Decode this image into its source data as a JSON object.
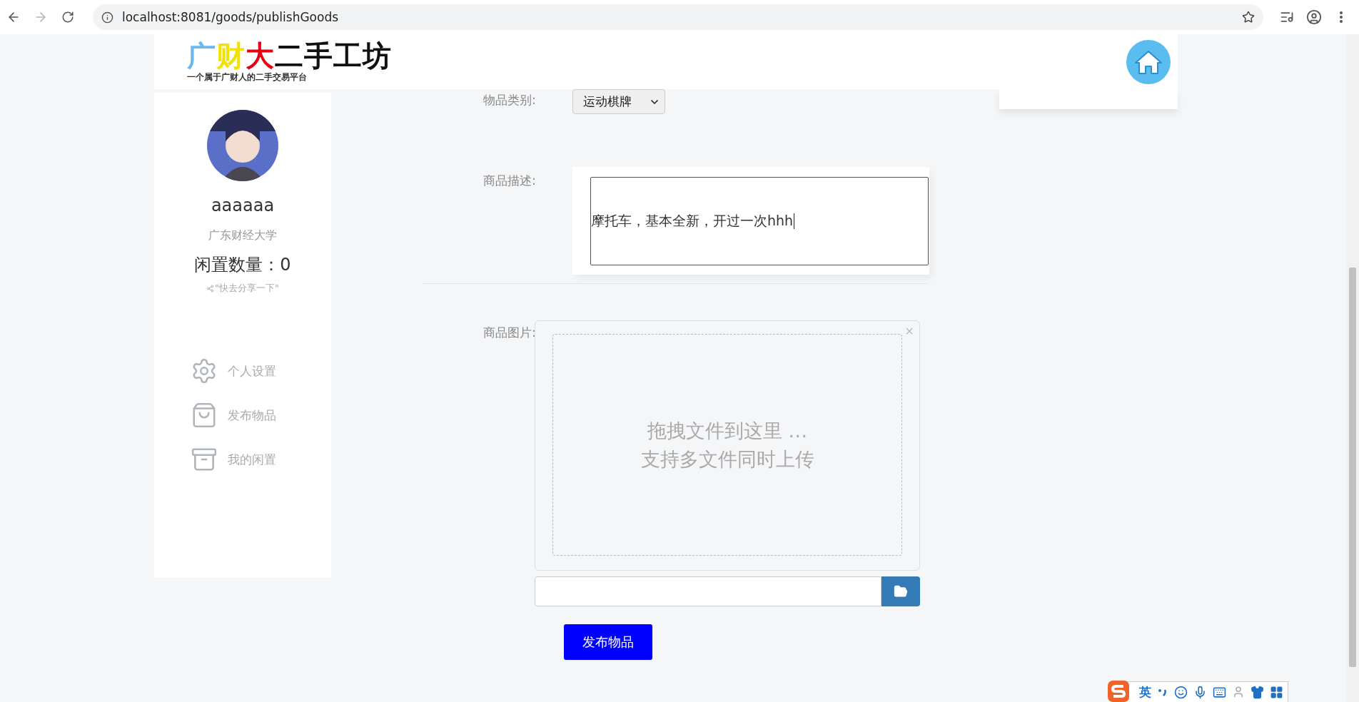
{
  "browser": {
    "url": "localhost:8081/goods/publishGoods"
  },
  "header": {
    "logo": [
      {
        "text": "广",
        "color": "#6cb8ee"
      },
      {
        "text": "财",
        "color": "#f2e200"
      },
      {
        "text": "大",
        "color": "#e60012"
      },
      {
        "text": "二手工坊",
        "color": "#111111"
      }
    ],
    "slogan": "一个属于广财人的二手交易平台"
  },
  "profile": {
    "username": "aaaaaa",
    "school": "广东财经大学",
    "idle_count": "闲置数量：0",
    "share": "\"快去分享一下\""
  },
  "menu": [
    {
      "label": "个人设置",
      "kind": "settings"
    },
    {
      "label": "发布物品",
      "kind": "publish"
    },
    {
      "label": "我的闲置",
      "kind": "archive"
    }
  ],
  "form": {
    "category": {
      "label": "物品类别:",
      "value": "运动棋牌"
    },
    "description": {
      "label": "商品描述:",
      "value": "摩托车，基本全新，开过一次hhh"
    },
    "images": {
      "label": "商品图片:",
      "drop_hint": [
        "拖拽文件到这里 …",
        "支持多文件同时上传"
      ],
      "close": "×"
    },
    "submit": "发布物品"
  },
  "ime": {
    "mode": "英"
  }
}
